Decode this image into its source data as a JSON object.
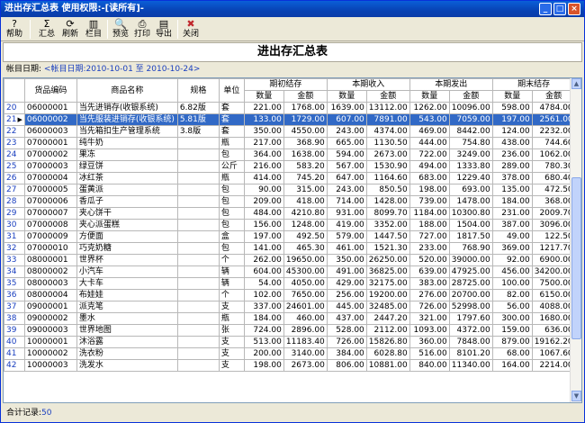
{
  "window": {
    "title": "进出存汇总表 使用权限:-[读所有]-"
  },
  "toolbar": [
    {
      "label": "帮助",
      "icon": "help-icon",
      "glyph": "?"
    },
    {
      "label": "汇总",
      "icon": "sum-icon",
      "glyph": "Σ"
    },
    {
      "label": "刷新",
      "icon": "refresh-icon",
      "glyph": "⟳"
    },
    {
      "label": "栏目",
      "icon": "columns-icon",
      "glyph": "▥"
    },
    {
      "label": "预览",
      "icon": "preview-icon",
      "glyph": "🔍"
    },
    {
      "label": "打印",
      "icon": "print-icon",
      "glyph": "⎙"
    },
    {
      "label": "导出",
      "icon": "export-icon",
      "glyph": "▤"
    },
    {
      "label": "关闭",
      "icon": "close-icon",
      "glyph": "✖"
    }
  ],
  "report": {
    "title": "进出存汇总表",
    "date_label": "帐目日期:",
    "date_value": "<帐目日期:2010-10-01 至 2010-10-24>"
  },
  "columns": {
    "code": "货品编码",
    "name": "商品名称",
    "spec": "规格",
    "unit": "单位",
    "opening": "期初结存",
    "income": "本期收入",
    "outgo": "本期发出",
    "closing": "期末结存",
    "qty": "数量",
    "amount": "金额"
  },
  "rows": [
    {
      "n": "20",
      "code": "06000001",
      "name": "当先进销存(收银系统)",
      "spec": "6.82版",
      "unit": "套",
      "v": [
        "221.00",
        "1768.00",
        "1639.00",
        "13112.00",
        "1262.00",
        "10096.00",
        "598.00",
        "4784.00"
      ]
    },
    {
      "n": "21",
      "code": "06000002",
      "name": "当先服装进销存(收银系统)",
      "spec": "5.81版",
      "unit": "套",
      "v": [
        "133.00",
        "1729.00",
        "607.00",
        "7891.00",
        "543.00",
        "7059.00",
        "197.00",
        "2561.00"
      ]
    },
    {
      "n": "22",
      "code": "06000003",
      "name": "当先箱扣生产管理系统",
      "spec": "3.8版",
      "unit": "套",
      "v": [
        "350.00",
        "4550.00",
        "243.00",
        "4374.00",
        "469.00",
        "8442.00",
        "124.00",
        "2232.00"
      ]
    },
    {
      "n": "23",
      "code": "07000001",
      "name": "纯牛奶",
      "spec": "",
      "unit": "瓶",
      "v": [
        "217.00",
        "368.90",
        "665.00",
        "1130.50",
        "444.00",
        "754.80",
        "438.00",
        "744.60"
      ]
    },
    {
      "n": "24",
      "code": "07000002",
      "name": "果冻",
      "spec": "",
      "unit": "包",
      "v": [
        "364.00",
        "1638.00",
        "594.00",
        "2673.00",
        "722.00",
        "3249.00",
        "236.00",
        "1062.00"
      ]
    },
    {
      "n": "25",
      "code": "07000003",
      "name": "绿豆饼",
      "spec": "",
      "unit": "公斤",
      "v": [
        "216.00",
        "583.20",
        "567.00",
        "1530.90",
        "494.00",
        "1333.80",
        "289.00",
        "780.30"
      ]
    },
    {
      "n": "26",
      "code": "07000004",
      "name": "冰红茶",
      "spec": "",
      "unit": "瓶",
      "v": [
        "414.00",
        "745.20",
        "647.00",
        "1164.60",
        "683.00",
        "1229.40",
        "378.00",
        "680.40"
      ]
    },
    {
      "n": "27",
      "code": "07000005",
      "name": "蛋黄派",
      "spec": "",
      "unit": "包",
      "v": [
        "90.00",
        "315.00",
        "243.00",
        "850.50",
        "198.00",
        "693.00",
        "135.00",
        "472.50"
      ]
    },
    {
      "n": "28",
      "code": "07000006",
      "name": "香瓜子",
      "spec": "",
      "unit": "包",
      "v": [
        "209.00",
        "418.00",
        "714.00",
        "1428.00",
        "739.00",
        "1478.00",
        "184.00",
        "368.00"
      ]
    },
    {
      "n": "29",
      "code": "07000007",
      "name": "夹心饼干",
      "spec": "",
      "unit": "包",
      "v": [
        "484.00",
        "4210.80",
        "931.00",
        "8099.70",
        "1184.00",
        "10300.80",
        "231.00",
        "2009.70"
      ]
    },
    {
      "n": "30",
      "code": "07000008",
      "name": "夹心派蛋糕",
      "spec": "",
      "unit": "包",
      "v": [
        "156.00",
        "1248.00",
        "419.00",
        "3352.00",
        "188.00",
        "1504.00",
        "387.00",
        "3096.00"
      ]
    },
    {
      "n": "31",
      "code": "07000009",
      "name": "方便面",
      "spec": "",
      "unit": "盒",
      "v": [
        "197.00",
        "492.50",
        "579.00",
        "1447.50",
        "727.00",
        "1817.50",
        "49.00",
        "122.50"
      ]
    },
    {
      "n": "32",
      "code": "07000010",
      "name": "巧克奶糖",
      "spec": "",
      "unit": "包",
      "v": [
        "141.00",
        "465.30",
        "461.00",
        "1521.30",
        "233.00",
        "768.90",
        "369.00",
        "1217.70"
      ]
    },
    {
      "n": "33",
      "code": "08000001",
      "name": "世界杯",
      "spec": "",
      "unit": "个",
      "v": [
        "262.00",
        "19650.00",
        "350.00",
        "26250.00",
        "520.00",
        "39000.00",
        "92.00",
        "6900.00"
      ]
    },
    {
      "n": "34",
      "code": "08000002",
      "name": "小汽车",
      "spec": "",
      "unit": "辆",
      "v": [
        "604.00",
        "45300.00",
        "491.00",
        "36825.00",
        "639.00",
        "47925.00",
        "456.00",
        "34200.00"
      ]
    },
    {
      "n": "35",
      "code": "08000003",
      "name": "大卡车",
      "spec": "",
      "unit": "辆",
      "v": [
        "54.00",
        "4050.00",
        "429.00",
        "32175.00",
        "383.00",
        "28725.00",
        "100.00",
        "7500.00"
      ]
    },
    {
      "n": "36",
      "code": "08000004",
      "name": "布娃娃",
      "spec": "",
      "unit": "个",
      "v": [
        "102.00",
        "7650.00",
        "256.00",
        "19200.00",
        "276.00",
        "20700.00",
        "82.00",
        "6150.00"
      ]
    },
    {
      "n": "37",
      "code": "09000001",
      "name": "派克笔",
      "spec": "",
      "unit": "支",
      "v": [
        "337.00",
        "24601.00",
        "445.00",
        "32485.00",
        "726.00",
        "52998.00",
        "56.00",
        "4088.00"
      ]
    },
    {
      "n": "38",
      "code": "09000002",
      "name": "墨水",
      "spec": "",
      "unit": "瓶",
      "v": [
        "184.00",
        "460.00",
        "437.00",
        "2447.20",
        "321.00",
        "1797.60",
        "300.00",
        "1680.00"
      ]
    },
    {
      "n": "39",
      "code": "09000003",
      "name": "世界地图",
      "spec": "",
      "unit": "张",
      "v": [
        "724.00",
        "2896.00",
        "528.00",
        "2112.00",
        "1093.00",
        "4372.00",
        "159.00",
        "636.00"
      ]
    },
    {
      "n": "40",
      "code": "10000001",
      "name": "沐浴露",
      "spec": "",
      "unit": "支",
      "v": [
        "513.00",
        "11183.40",
        "726.00",
        "15826.80",
        "360.00",
        "7848.00",
        "879.00",
        "19162.20"
      ]
    },
    {
      "n": "41",
      "code": "10000002",
      "name": "洗衣粉",
      "spec": "",
      "unit": "支",
      "v": [
        "200.00",
        "3140.00",
        "384.00",
        "6028.80",
        "516.00",
        "8101.20",
        "68.00",
        "1067.60"
      ]
    },
    {
      "n": "42",
      "code": "10000003",
      "name": "洗发水",
      "spec": "",
      "unit": "支",
      "v": [
        "198.00",
        "2673.00",
        "806.00",
        "10881.00",
        "840.00",
        "11340.00",
        "164.00",
        "2214.00"
      ]
    }
  ],
  "selected_row": "21",
  "status": {
    "label": "合计记录:",
    "value": "50"
  }
}
